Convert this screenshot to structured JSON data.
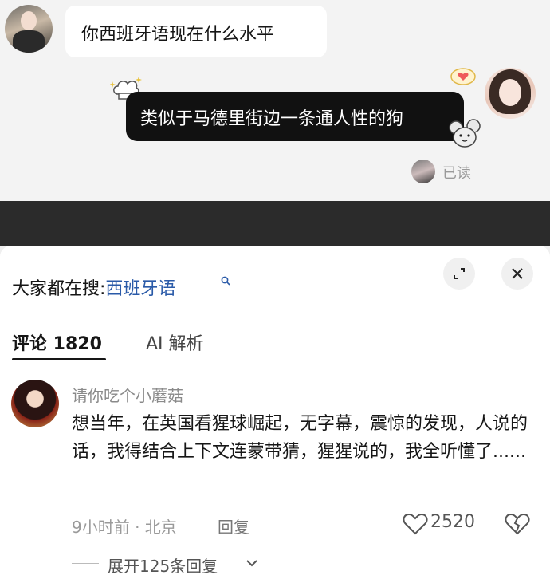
{
  "chat": {
    "incoming_message": "你西班牙语现在什么水平",
    "outgoing_message": "类似于马德里街边一条通人性的狗",
    "read_status": "已读"
  },
  "search": {
    "label": "大家都在搜:",
    "term": "西班牙语"
  },
  "tabs": [
    {
      "label": "评论 1820"
    },
    {
      "label": "AI 解析"
    }
  ],
  "comment": {
    "username": "请你吃个小蘑菇",
    "text": "想当年，在英国看猩球崛起，无字幕，震惊的发现，人说的话，我得结合上下文连蒙带猜，猩猩说的，我全听懂了......",
    "meta": "9小时前 · 北京",
    "reply_label": "回复",
    "likes": "2520",
    "expand_replies": "展开125条回复"
  },
  "colors": {
    "search_term": "#2a5aa8",
    "bubble_out_bg": "#111111",
    "band": "#2b2b2b"
  }
}
